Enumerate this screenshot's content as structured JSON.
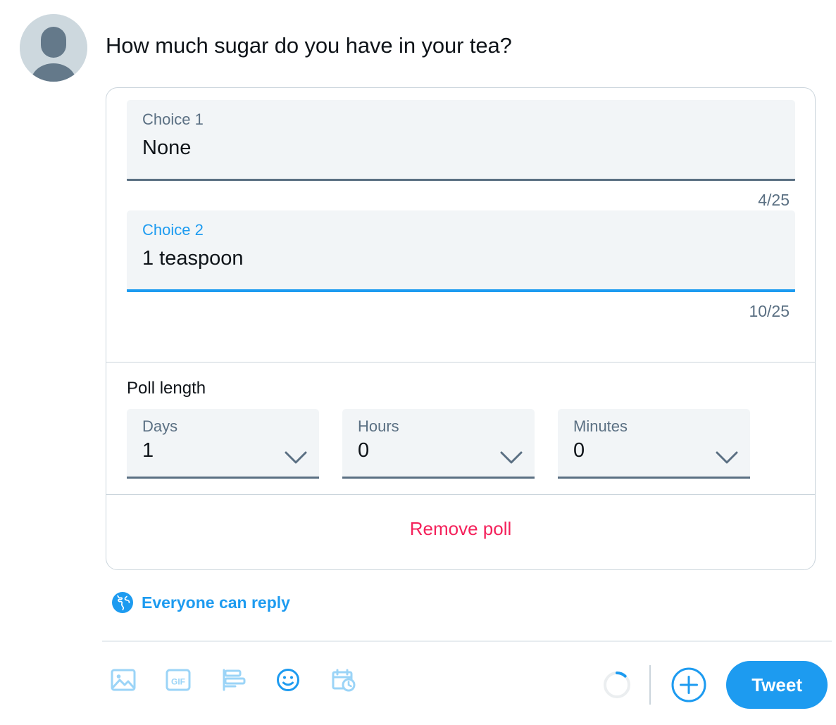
{
  "composer": {
    "avatar_alt": "default user avatar",
    "tweet_text": "How much sugar do you have in your tea?"
  },
  "poll": {
    "choices": [
      {
        "label": "Choice 1",
        "value": "None",
        "counter": "4/25",
        "focused": false
      },
      {
        "label": "Choice 2",
        "value": "1 teaspoon",
        "counter": "10/25",
        "focused": true
      }
    ],
    "add_choice_icon": "plus-icon",
    "length": {
      "title": "Poll length",
      "fields": [
        {
          "label": "Days",
          "value": "1"
        },
        {
          "label": "Hours",
          "value": "0"
        },
        {
          "label": "Minutes",
          "value": "0"
        }
      ]
    },
    "remove_label": "Remove poll"
  },
  "reply_scope": {
    "icon": "globe-icon",
    "label": "Everyone can reply"
  },
  "toolbar": {
    "items": [
      {
        "icon": "image-icon",
        "name": "media-button"
      },
      {
        "icon": "gif-icon",
        "name": "gif-button"
      },
      {
        "icon": "poll-icon",
        "name": "poll-button"
      },
      {
        "icon": "emoji-icon",
        "name": "emoji-button"
      },
      {
        "icon": "schedule-icon",
        "name": "schedule-button"
      }
    ],
    "char_progress_percent": 12,
    "add_thread_icon": "plus-circle-icon",
    "tweet_label": "Tweet"
  },
  "colors": {
    "accent": "#1D9BF0",
    "accent_faded": "#9BD4F7",
    "danger": "#F4215B",
    "muted": "#5B7083",
    "field_bg": "#F2F5F7",
    "border": "#CBD5DC",
    "text": "#0F1419"
  }
}
